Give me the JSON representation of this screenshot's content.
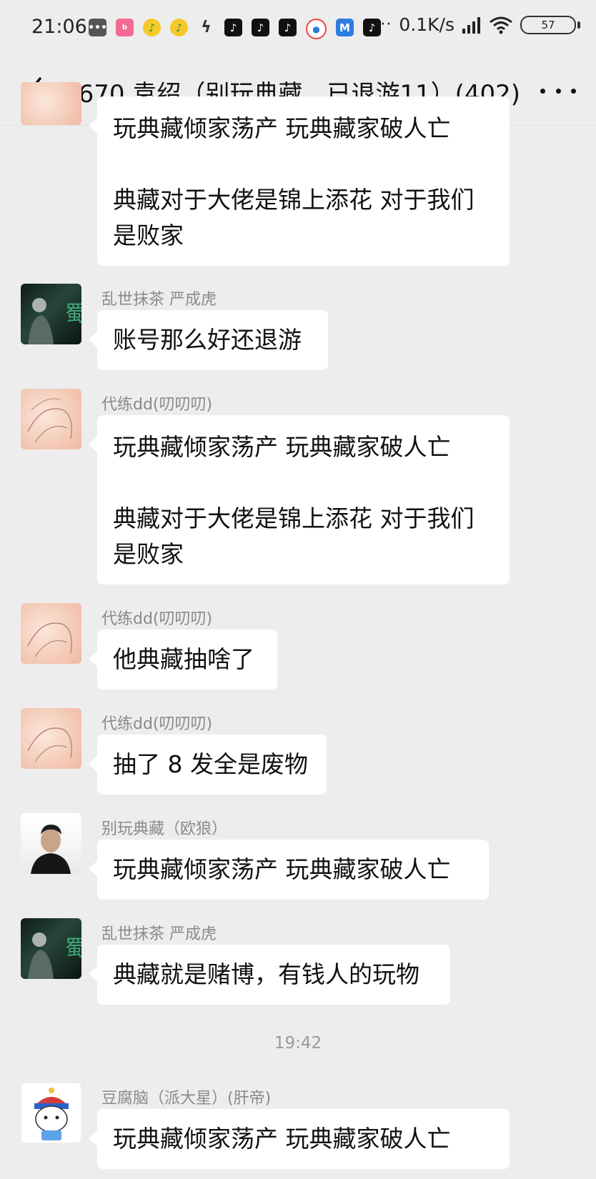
{
  "status_bar": {
    "time": "21:06",
    "network_speed": "0.1K/s",
    "battery": "57",
    "overflow": "···",
    "notification_icons": [
      "message-icon",
      "bilibili-icon",
      "music-icon",
      "music-icon",
      "bolt-icon",
      "tiktok-icon",
      "tiktok-icon",
      "tiktok-icon",
      "browser-icon",
      "maps-icon",
      "tiktok-icon"
    ]
  },
  "header": {
    "title": "1670 袁绍（别玩典藏，已退游11）(402)"
  },
  "messages": [
    {
      "sender": "",
      "lines": [
        "玩典藏倾家荡产 玩典藏家破人亡",
        "",
        "典藏对于大佬是锦上添花 对于我们",
        "是败家"
      ]
    },
    {
      "sender": "乱世抹茶 严成虎",
      "lines": [
        "账号那么好还退游"
      ]
    },
    {
      "sender": "代练dd(叨叨叨)",
      "lines": [
        "玩典藏倾家荡产 玩典藏家破人亡",
        "",
        "典藏对于大佬是锦上添花 对于我们",
        "是败家"
      ]
    },
    {
      "sender": "代练dd(叨叨叨)",
      "lines": [
        "他典藏抽啥了"
      ]
    },
    {
      "sender": "代练dd(叨叨叨)",
      "lines": [
        "抽了 8 发全是废物"
      ]
    },
    {
      "sender": "别玩典藏（欧狼）",
      "lines": [
        "玩典藏倾家荡产 玩典藏家破人亡"
      ]
    },
    {
      "sender": "乱世抹茶 严成虎",
      "lines": [
        "典藏就是赌博，有钱人的玩物"
      ]
    },
    {
      "sender": "豆腐脑（派大星）(肝帝)",
      "lines": [
        "玩典藏倾家荡产 玩典藏家破人亡"
      ]
    }
  ],
  "timestamp": "19:42",
  "colors": {
    "background": "#ededed",
    "bubble": "#ffffff",
    "sender_name": "#8a8a8a"
  }
}
